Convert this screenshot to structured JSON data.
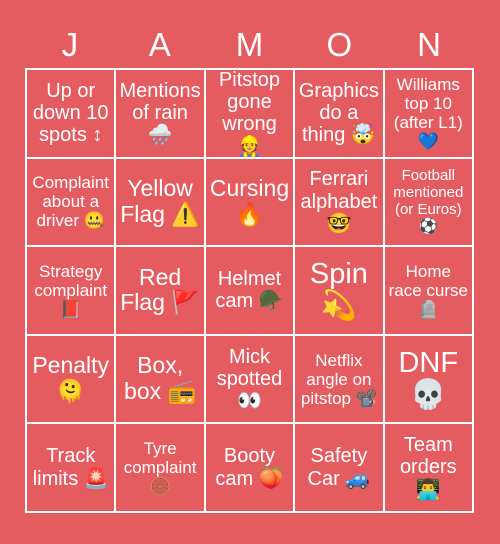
{
  "card": {
    "background_color": "#e45c5f",
    "grid_line_color": "#ffffff",
    "text_color": "#ffffff",
    "header": {
      "letters": [
        "J",
        "A",
        "M",
        "O",
        "N"
      ]
    },
    "rows": [
      [
        {
          "text": "Up or down 10 spots ↕",
          "size": "fs-md",
          "icon": "up-down-arrow-icon"
        },
        {
          "text": "Mentions of rain 🌧️",
          "size": "fs-md",
          "icon": "cloud-with-rain-icon"
        },
        {
          "text": "Pitstop gone wrong 👷",
          "size": "fs-md",
          "icon": "construction-worker-icon"
        },
        {
          "text": "Graphics do a thing 🤯",
          "size": "fs-md",
          "icon": "exploding-head-icon"
        },
        {
          "text": "Williams top 10 (after L1) 💙",
          "size": "fs-sm",
          "icon": "blue-heart-icon"
        }
      ],
      [
        {
          "text": "Complaint about a driver 🤐",
          "size": "fs-sm",
          "icon": "zipper-mouth-face-icon"
        },
        {
          "text": "Yellow Flag ⚠️",
          "size": "fs-lg",
          "icon": "warning-sign-icon"
        },
        {
          "text": "Cursing 🔥",
          "size": "fs-lg",
          "icon": "fire-icon"
        },
        {
          "text": "Ferrari alphabet 🤓",
          "size": "fs-md",
          "icon": "nerd-face-icon"
        },
        {
          "text": "Football mentioned (or Euros) ⚽",
          "size": "fs-xs",
          "icon": "soccer-ball-icon"
        }
      ],
      [
        {
          "text": "Strategy complaint 📕",
          "size": "fs-sm",
          "icon": "closed-book-icon"
        },
        {
          "text": "Red Flag 🚩",
          "size": "fs-lg",
          "icon": "triangular-flag-icon"
        },
        {
          "text": "Helmet cam 🪖",
          "size": "fs-md",
          "icon": "military-helmet-icon"
        },
        {
          "text": "Spin 💫",
          "size": "fs-xl",
          "icon": "dizzy-star-icon"
        },
        {
          "text": "Home race curse 🪦",
          "size": "fs-sm",
          "icon": "headstone-icon"
        }
      ],
      [
        {
          "text": "Penalty 🫠",
          "size": "fs-lg",
          "icon": "melting-face-icon"
        },
        {
          "text": "Box, box 📻",
          "size": "fs-lg",
          "icon": "radio-icon"
        },
        {
          "text": "Mick spotted 👀",
          "size": "fs-md",
          "icon": "eyes-icon"
        },
        {
          "text": "Netflix angle on pitstop 📽️",
          "size": "fs-sm",
          "icon": "film-projector-icon"
        },
        {
          "text": "DNF 💀",
          "size": "fs-xl",
          "icon": "skull-icon"
        }
      ],
      [
        {
          "text": "Track limits 🚨",
          "size": "fs-md",
          "icon": "police-car-light-icon"
        },
        {
          "text": "Tyre complaint 🛞",
          "size": "fs-sm",
          "icon": "wheel-icon"
        },
        {
          "text": "Booty cam 🍑",
          "size": "fs-md",
          "icon": "peach-icon"
        },
        {
          "text": "Safety Car 🚙",
          "size": "fs-md",
          "icon": "suv-icon"
        },
        {
          "text": "Team orders 👨‍💻",
          "size": "fs-md",
          "icon": "man-technologist-icon"
        }
      ]
    ]
  }
}
